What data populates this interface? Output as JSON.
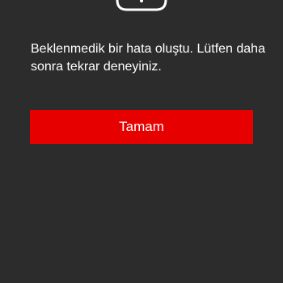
{
  "dialog": {
    "message": "Beklenmedik bir hata oluştu. Lütfen daha sonra tekrar deneyiniz.",
    "ok_label": "Tamam",
    "icon": "error-cloud-icon"
  },
  "colors": {
    "background": "#2c2c2c",
    "accent": "#e60000",
    "text": "#ffffff"
  }
}
